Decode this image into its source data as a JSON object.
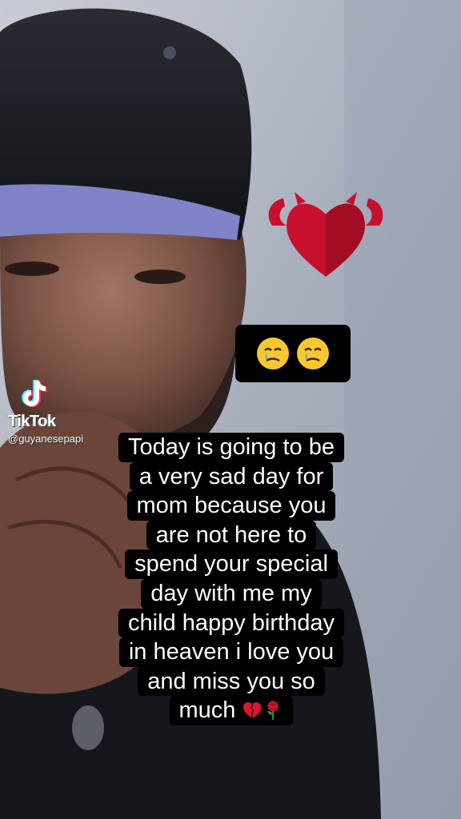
{
  "caption": {
    "lines": [
      "Today is going to be",
      "a very sad day for",
      "mom because you",
      "are not here to",
      "spend your special",
      "day with me my",
      "child happy birthday",
      "in heaven i love you",
      "and miss you so",
      "much"
    ],
    "end_icons": [
      "broken-heart-icon",
      "rose-icon"
    ]
  },
  "sticker": {
    "emojis": [
      "face-holding-back-tears-icon",
      "face-holding-back-tears-icon"
    ]
  },
  "watermark": {
    "brand": "TikTok",
    "handle": "@guyanesepapi"
  },
  "colors": {
    "caption_bg": "#000000",
    "caption_text": "#ffffff",
    "heart_red": "#c8102e",
    "tiktok_cyan": "#25f4ee",
    "tiktok_red": "#fe2c55"
  }
}
